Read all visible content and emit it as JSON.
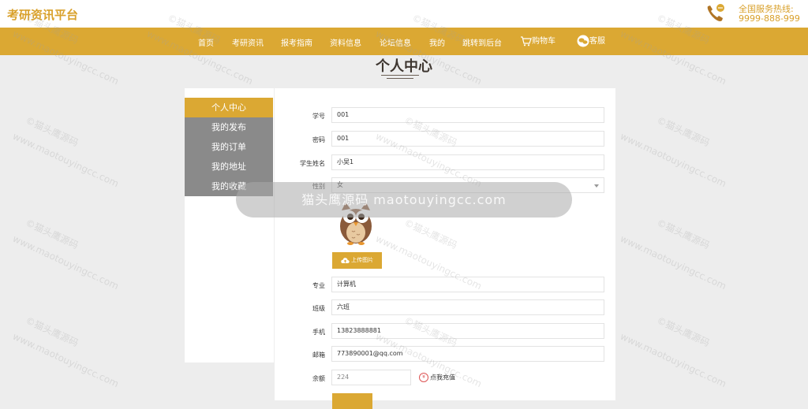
{
  "header": {
    "brand": "考研资讯平台",
    "hotline_label": "全国服务热线:",
    "hotline_number": "9999-888-999"
  },
  "nav": {
    "items": [
      {
        "label": "首页"
      },
      {
        "label": "考研资讯"
      },
      {
        "label": "报考指南"
      },
      {
        "label": "资料信息"
      },
      {
        "label": "论坛信息"
      },
      {
        "label": "我的"
      },
      {
        "label": "跳转到后台"
      },
      {
        "label": "购物车"
      },
      {
        "label": "客服"
      }
    ]
  },
  "page_title": "个人中心",
  "sidebar": {
    "items": [
      {
        "label": "个人中心",
        "active": true
      },
      {
        "label": "我的发布"
      },
      {
        "label": "我的订单"
      },
      {
        "label": "我的地址"
      },
      {
        "label": "我的收藏"
      }
    ]
  },
  "form": {
    "fields": {
      "student_id": {
        "label": "学号",
        "value": "001"
      },
      "password": {
        "label": "密码",
        "value": "001"
      },
      "name": {
        "label": "学生姓名",
        "value": "小吴1"
      },
      "gender": {
        "label": "性别",
        "value": "女"
      },
      "major": {
        "label": "专业",
        "value": "计算机"
      },
      "class": {
        "label": "班级",
        "value": "六班"
      },
      "phone": {
        "label": "手机",
        "value": "13823888881"
      },
      "email": {
        "label": "邮箱",
        "value": "773890001@qq.com"
      },
      "balance": {
        "label": "余额",
        "value": "224"
      }
    },
    "upload_label": "上传图片",
    "recharge_label": "点我充值"
  },
  "watermark": {
    "cn": "©猫头鹰源码",
    "en": "www.maotouyingcc.com",
    "banner": "猫头鹰源码 maotouyingcc.com"
  },
  "colors": {
    "accent": "#dba833",
    "sidebar_inactive": "#8a8a8a",
    "background": "#ededed"
  }
}
